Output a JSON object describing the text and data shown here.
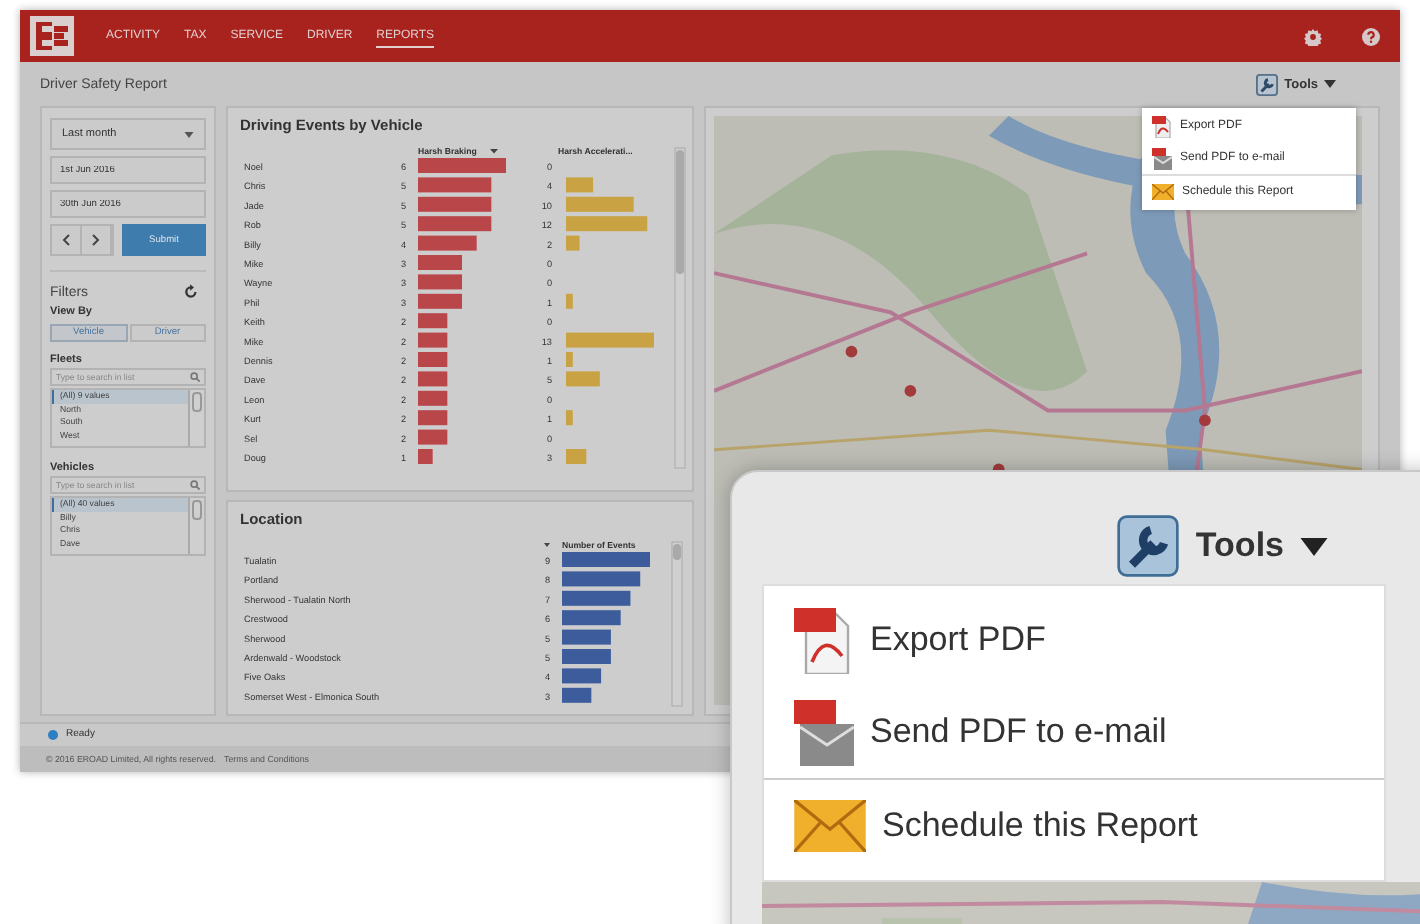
{
  "nav": {
    "items": [
      {
        "label": "ACTIVITY",
        "selected": false
      },
      {
        "label": "TAX",
        "selected": false
      },
      {
        "label": "SERVICE",
        "selected": false
      },
      {
        "label": "DRIVER",
        "selected": false
      },
      {
        "label": "REPORTS",
        "selected": true
      }
    ]
  },
  "page_title": "Driver Safety Report",
  "tools": {
    "label": "Tools",
    "menu": [
      {
        "label": "Export PDF",
        "kind": "pdf",
        "divider": false
      },
      {
        "label": "Send PDF to e-mail",
        "kind": "pdf-email",
        "divider": false
      },
      {
        "label": "Schedule this Report",
        "kind": "schedule",
        "divider": true
      }
    ]
  },
  "date_range": {
    "period": "Last month",
    "from": "1st Jun 2016",
    "to": "30th Jun 2016",
    "submit": "Submit"
  },
  "filters": {
    "title": "Filters",
    "view_by": {
      "label": "View By",
      "options": [
        {
          "label": "Vehicle",
          "selected": true
        },
        {
          "label": "Driver",
          "selected": false
        }
      ]
    },
    "lists": [
      {
        "label": "Fleets",
        "placeholder": "Type to search in list",
        "items": [
          {
            "label": "(All) 9 values",
            "selected": true
          },
          {
            "label": "North",
            "selected": false
          },
          {
            "label": "South",
            "selected": false
          },
          {
            "label": "West",
            "selected": false
          }
        ]
      },
      {
        "label": "Vehicles",
        "placeholder": "Type to search in list",
        "items": [
          {
            "label": "(All) 40 values",
            "selected": true
          },
          {
            "label": "Billy",
            "selected": false
          },
          {
            "label": "Chris",
            "selected": false
          },
          {
            "label": "Dave",
            "selected": false
          }
        ]
      }
    ]
  },
  "events_panel": {
    "title": "Driving Events by Vehicle",
    "braking": {
      "chart_data": {
        "type": "bar",
        "orientation": "horizontal",
        "data_labels": true,
        "categories": [
          "Noel",
          "Chris",
          "Jade",
          "Rob",
          "Billy",
          "Mike",
          "Wayne",
          "Phil",
          "Keith",
          "Mike",
          "Dennis",
          "Dave",
          "Leon",
          "Kurt",
          "Sel",
          "Doug"
        ],
        "series": [
          {
            "name": "Harsh Braking",
            "color": "#b9474a",
            "values": [
              6,
              5,
              5,
              5,
              4,
              3,
              3,
              3,
              2,
              2,
              2,
              2,
              2,
              2,
              2,
              1
            ]
          }
        ]
      }
    },
    "acceleration": {
      "chart_data": {
        "type": "bar",
        "orientation": "horizontal",
        "data_labels": true,
        "series": [
          {
            "name": "Harsh Accelerati...",
            "color": "#c8a243",
            "values": [
              0,
              4,
              10,
              12,
              2,
              0,
              0,
              1,
              0,
              13,
              1,
              5,
              0,
              1,
              0,
              3
            ]
          }
        ]
      }
    }
  },
  "location_panel": {
    "title": "Location",
    "chart_data": {
      "type": "bar",
      "orientation": "horizontal",
      "data_labels": true,
      "categories": [
        "Tualatin",
        "Portland",
        "Sherwood - Tualatin North",
        "Crestwood",
        "Sherwood",
        "Ardenwald - Woodstock",
        "Five Oaks",
        "Somerset West - Elmonica South"
      ],
      "series": [
        {
          "name": "Number of Events",
          "color": "#3d5c9c",
          "values": [
            9,
            8,
            7,
            6,
            5,
            5,
            4,
            3
          ]
        }
      ]
    }
  },
  "status": "Ready",
  "footer": {
    "copyright": "© 2016 EROAD Limited, All rights reserved.",
    "link": "Terms and Conditions"
  },
  "callout": {
    "tools_label": "Tools",
    "menu": [
      {
        "label": "Export PDF",
        "kind": "pdf",
        "divider": false
      },
      {
        "label": "Send PDF to e-mail",
        "kind": "pdf-email",
        "divider": false
      },
      {
        "label": "Schedule this Report",
        "kind": "schedule",
        "divider": true
      }
    ]
  }
}
